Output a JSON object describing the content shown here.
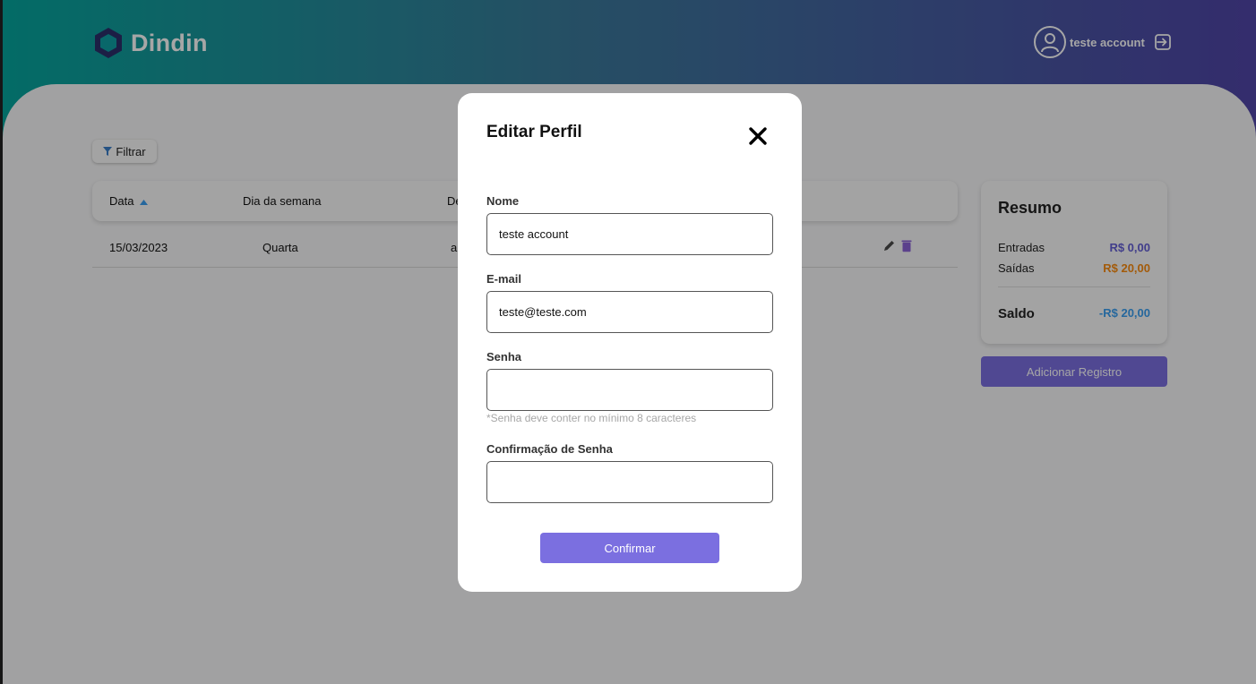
{
  "header": {
    "brand": "Dindin",
    "user_name": "teste account"
  },
  "toolbar": {
    "filter_label": "Filtrar"
  },
  "table": {
    "columns": [
      "Data",
      "Dia da semana",
      "De"
    ],
    "rows": [
      {
        "date": "15/03/2023",
        "weekday": "Quarta",
        "description_partial": "al"
      }
    ]
  },
  "summary": {
    "title": "Resumo",
    "entradas_label": "Entradas",
    "entradas_value": "R$ 0,00",
    "saidas_label": "Saídas",
    "saidas_value": "R$ 20,00",
    "saldo_label": "Saldo",
    "saldo_value": "-R$ 20,00",
    "add_button": "Adicionar Registro"
  },
  "modal": {
    "title": "Editar Perfil",
    "name_label": "Nome",
    "name_value": "teste account",
    "email_label": "E-mail",
    "email_value": "teste@teste.com",
    "password_label": "Senha",
    "password_value": "",
    "password_hint": "*Senha deve conter no mínimo 8 caracteres",
    "confirm_password_label": "Confirmação de Senha",
    "confirm_password_value": "",
    "confirm_button": "Confirmar"
  },
  "colors": {
    "accent": "#7b6fe0",
    "entradas": "#645fd6",
    "saidas": "#fa8c10",
    "saldo": "#3a9ff1",
    "logo": "#2b2f6b"
  },
  "icons": [
    "hexagon-logo-icon",
    "user-avatar-icon",
    "logout-icon",
    "filter-icon",
    "sort-up-icon",
    "pencil-icon",
    "trash-icon",
    "close-icon"
  ]
}
